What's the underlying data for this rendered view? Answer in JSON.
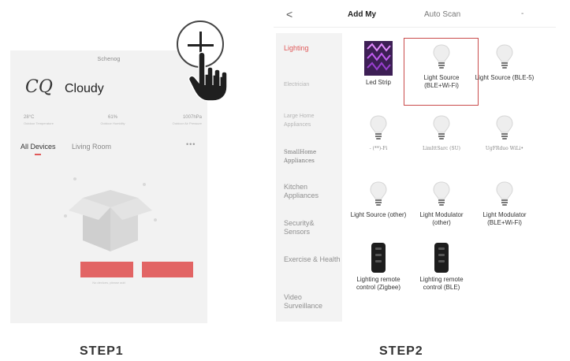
{
  "step1": {
    "header": "Schenog",
    "weather": {
      "icon_glyph": "CQ",
      "label": "Cloudy"
    },
    "stats": [
      {
        "value": "28°C",
        "label": "Outdoor Temperature"
      },
      {
        "value": "61%",
        "label": "Outdoor Humidity"
      },
      {
        "value": "1007hPa",
        "label": "Outdoor Air Pressure"
      }
    ],
    "tabs": [
      "All Devices",
      "Living Room"
    ],
    "more": "•••",
    "add_button_label": "",
    "scan_button_label": "",
    "empty_message": "No devices, please add",
    "colors": {
      "accent": "#e26464",
      "panel": "#f2f2f2"
    },
    "add_icon": "plus-circle-icon",
    "hand_icon": "pointing-hand-icon"
  },
  "step2": {
    "back_glyph": "<",
    "tabs": {
      "manual": "Add My",
      "auto": "Auto Scan"
    },
    "extra": "-",
    "categories": [
      "Lighting",
      "Electrician",
      "Large Home Appliances",
      "SmallHome Appliances",
      "Kitchen Appliances",
      "Security& Sensors",
      "Exercise & Health",
      "Video Surveillance"
    ],
    "devices": [
      {
        "name": "Led Strip",
        "icon": "led-strip-icon"
      },
      {
        "name": "Light Source (BLE+Wi-Fi)",
        "icon": "bulb-icon"
      },
      {
        "name": "Light Source (BLE-5)",
        "icon": "bulb-icon"
      },
      {
        "name": "- (**)-Fi",
        "icon": "bulb-icon"
      },
      {
        "name": "LimlttSarc (SU)",
        "icon": "bulb-icon"
      },
      {
        "name": "UgFRduo WiLi•",
        "icon": "bulb-icon"
      },
      {
        "name": "Light Source (other)",
        "icon": "bulb-icon"
      },
      {
        "name": "Light Modulator (other)",
        "icon": "bulb-icon"
      },
      {
        "name": "Light Modulator (BLE+Wi-Fi)",
        "icon": "bulb-icon"
      },
      {
        "name": "Lighting remote control (Zigbee)",
        "icon": "remote-icon"
      },
      {
        "name": "Lighting remote control (BLE)",
        "icon": "remote-icon"
      }
    ],
    "colors": {
      "accent": "#e05a5a",
      "selection": "#c94b4b"
    }
  },
  "labels": {
    "step1": "STEP1",
    "step2": "STEP2"
  }
}
